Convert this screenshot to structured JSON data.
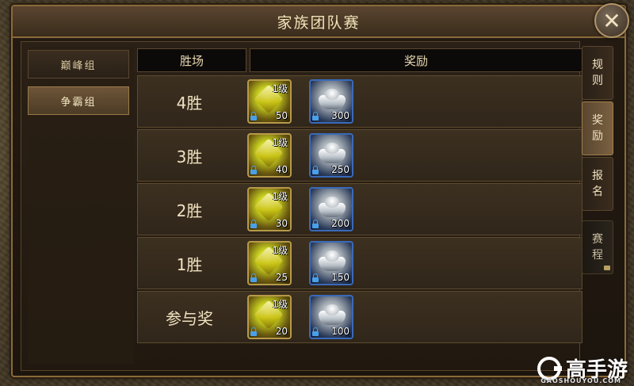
{
  "window": {
    "title": "家族团队赛",
    "close_icon": "✕"
  },
  "groups": [
    {
      "label": "巅峰组",
      "active": false
    },
    {
      "label": "争霸组",
      "active": true
    }
  ],
  "table": {
    "headers": {
      "wins": "胜场",
      "reward": "奖励"
    },
    "rows": [
      {
        "label": "4胜",
        "gold": {
          "level": "1级",
          "count": "50"
        },
        "silver": {
          "count": "300"
        }
      },
      {
        "label": "3胜",
        "gold": {
          "level": "1级",
          "count": "40"
        },
        "silver": {
          "count": "250"
        }
      },
      {
        "label": "2胜",
        "gold": {
          "level": "1级",
          "count": "30"
        },
        "silver": {
          "count": "200"
        }
      },
      {
        "label": "1胜",
        "gold": {
          "level": "1级",
          "count": "25"
        },
        "silver": {
          "count": "150"
        }
      },
      {
        "label": "参与奖",
        "gold": {
          "level": "1级",
          "count": "20"
        },
        "silver": {
          "count": "100"
        }
      }
    ]
  },
  "side_tabs": [
    {
      "chars": [
        "规",
        "则"
      ],
      "state": "normal"
    },
    {
      "chars": [
        "奖",
        "励"
      ],
      "state": "active"
    },
    {
      "chars": [
        "报",
        "名"
      ],
      "state": "normal"
    },
    {
      "chars": [
        "赛",
        "程"
      ],
      "state": "dark",
      "locked": true
    }
  ],
  "watermark": {
    "brand": "高手游",
    "sub": "GAOSHOUYOU.COM"
  },
  "colors": {
    "border_gold": "#8a6a3a",
    "text_cream": "#f0e2c0",
    "silver_frame": "#3a6ab8"
  }
}
